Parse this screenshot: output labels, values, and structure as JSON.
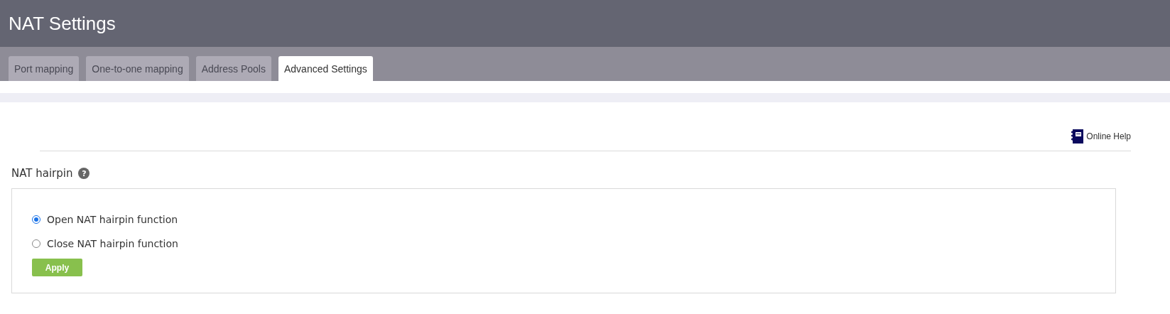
{
  "header": {
    "title": "NAT Settings"
  },
  "tabs": [
    {
      "label": "Port mapping",
      "selected": false
    },
    {
      "label": "One-to-one mapping",
      "selected": false
    },
    {
      "label": "Address Pools",
      "selected": false
    },
    {
      "label": "Advanced Settings",
      "selected": true
    }
  ],
  "help_link": {
    "label": "Online Help"
  },
  "section": {
    "title": "NAT hairpin",
    "hint_icon": "?"
  },
  "options": [
    {
      "label": "Open NAT hairpin function",
      "selected": true
    },
    {
      "label": "Close NAT hairpin function",
      "selected": false
    }
  ],
  "apply_button": {
    "label": "Apply"
  }
}
